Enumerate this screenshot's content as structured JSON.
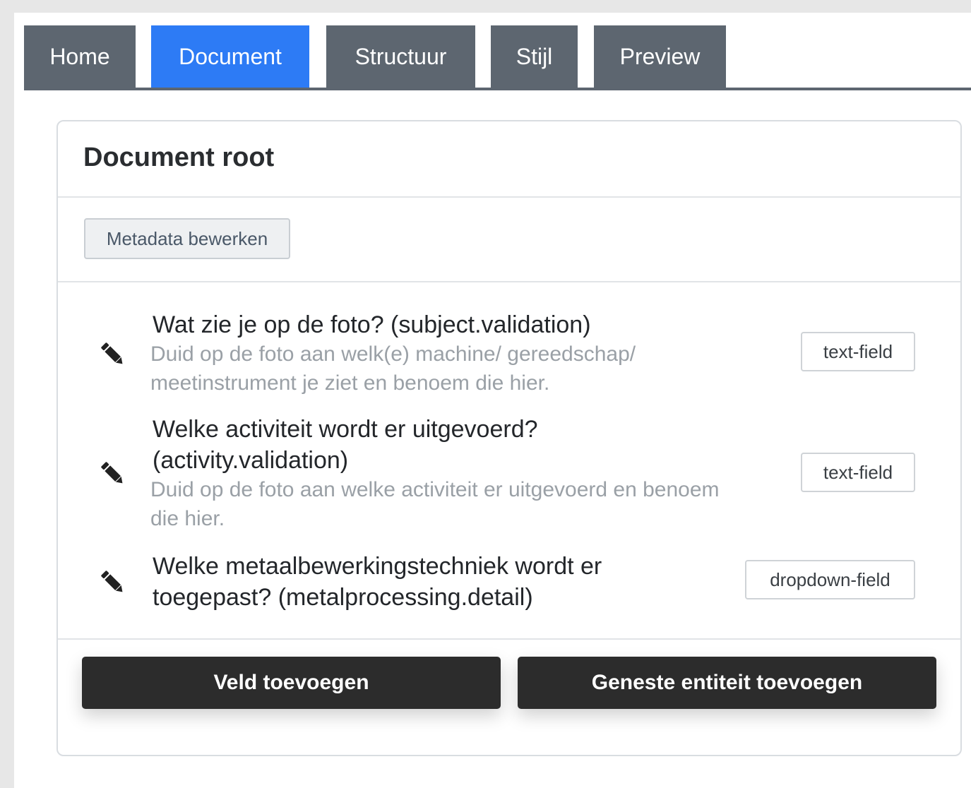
{
  "tabs": [
    {
      "label": "Home",
      "active": false
    },
    {
      "label": "Document",
      "active": true
    },
    {
      "label": "Structuur",
      "active": false
    },
    {
      "label": "Stijl",
      "active": false
    },
    {
      "label": "Preview",
      "active": false
    }
  ],
  "card": {
    "title": "Document root",
    "metadata_button": "Metadata bewerken"
  },
  "fields": [
    {
      "icon": "pencil-icon",
      "title": "Wat zie je op de foto? (subject.validation)",
      "description": "Duid op de foto aan welk(e) machine/ gereedschap/ meetinstrument je ziet en benoem die hier.",
      "type": "text-field"
    },
    {
      "icon": "pencil-icon",
      "title": "Welke activiteit wordt er uitgevoerd? (activity.validation)",
      "description": "Duid op de foto aan welke activiteit er uitgevoerd en benoem die hier.",
      "type": "text-field"
    },
    {
      "icon": "pencil-icon",
      "title": "Welke metaalbewerkingstechniek wordt er toegepast? (metalprocessing.detail)",
      "description": "",
      "type": "dropdown-field"
    }
  ],
  "actions": {
    "add_field": "Veld toevoegen",
    "add_nested": "Geneste entiteit toevoegen"
  },
  "colors": {
    "tab_inactive": "#5d6670",
    "tab_active": "#2d7bf5",
    "button_dark": "#2c2c2c",
    "description_text": "#9aa0a6"
  }
}
